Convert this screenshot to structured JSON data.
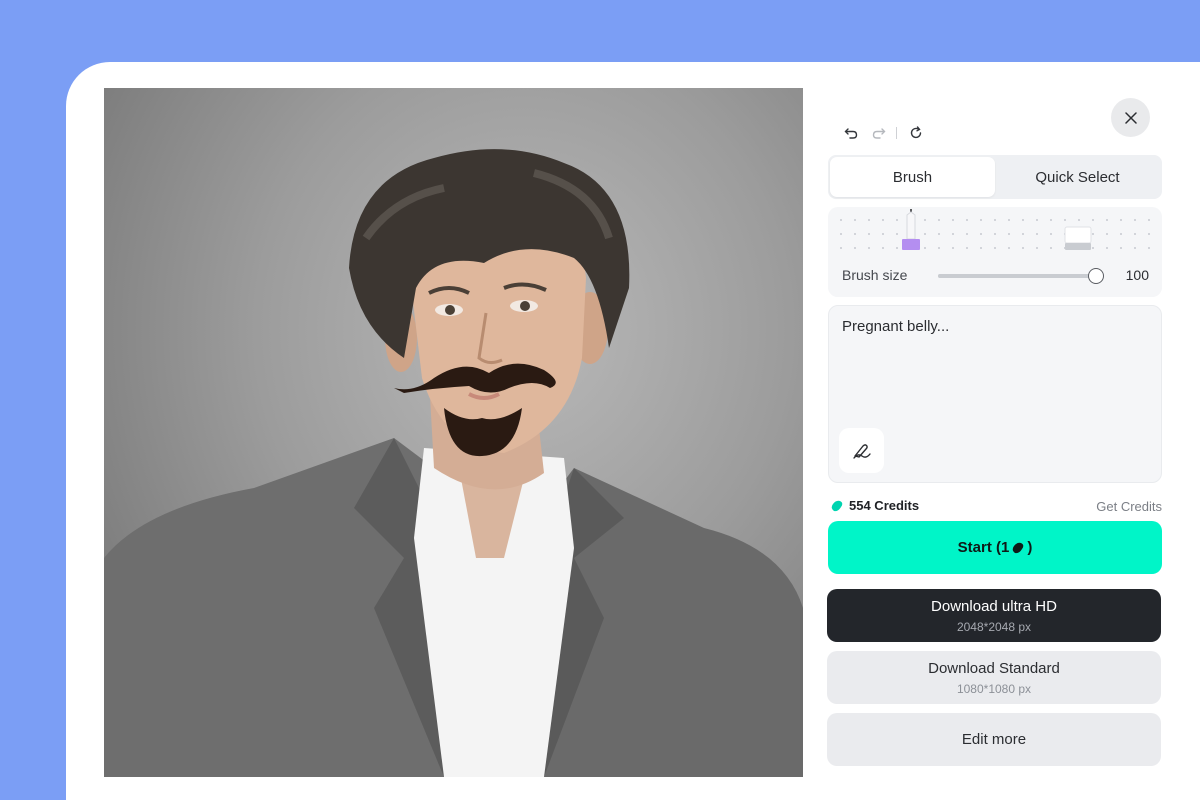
{
  "editor": {
    "tabs": [
      {
        "label": "Brush",
        "active": true
      },
      {
        "label": "Quick Select",
        "active": false
      }
    ],
    "brush": {
      "label": "Brush size",
      "value": "100",
      "level": 1.0
    },
    "prompt": {
      "text": "Pregnant belly..."
    },
    "credits": {
      "amount": "554 Credits",
      "get_label": "Get Credits"
    },
    "start": {
      "label": "Start (1",
      "suffix": ")"
    },
    "download_hd": {
      "label": "Download ultra HD",
      "size": "2048*2048 px"
    },
    "download_standard": {
      "label": "Download Standard",
      "size": "1080*1080 px"
    },
    "edit_more": {
      "label": "Edit more"
    }
  },
  "icons": {
    "undo": "undo-icon",
    "redo": "redo-icon",
    "reset": "reset-icon",
    "close": "close-icon",
    "brush_tool": "brush-pen-icon",
    "eraser_tool": "eraser-icon",
    "prompt_tool": "magic-draw-icon",
    "credit": "credit-bean-icon"
  },
  "colors": {
    "background": "#7b9ef5",
    "accent": "#00f5c8",
    "brush_purple": "#b48ef0",
    "dark_button": "#23262b"
  }
}
